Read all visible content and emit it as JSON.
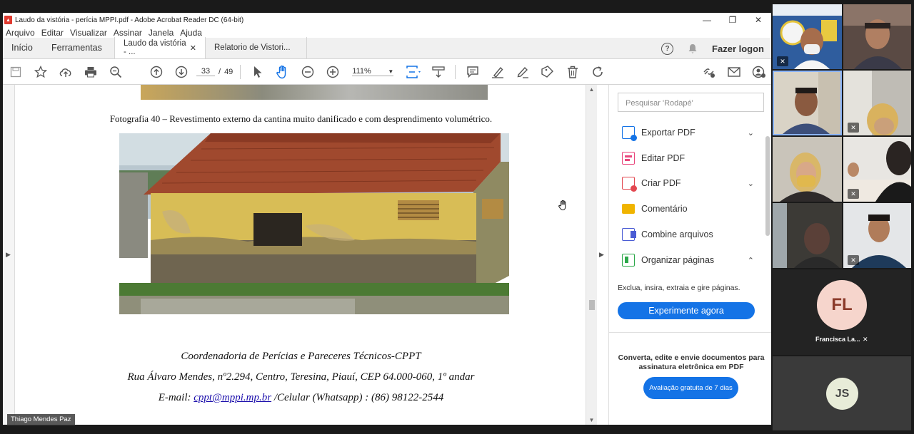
{
  "window": {
    "title": "Laudo da vistória - perícia MPPI.pdf - Adobe Acrobat Reader DC (64-bit)",
    "minimize": "—",
    "maximize": "❐",
    "close": "✕"
  },
  "menu": [
    "Arquivo",
    "Editar",
    "Visualizar",
    "Assinar",
    "Janela",
    "Ajuda"
  ],
  "tabs": {
    "home": "Início",
    "tools": "Ferramentas",
    "doc1": "Laudo da vistória - ...",
    "doc2": "Relatorio de Vistori...",
    "close": "✕",
    "login": "Fazer logon"
  },
  "toolbar": {
    "current_page": "33",
    "page_sep": "/",
    "total_pages": "49",
    "zoom": "111%"
  },
  "document": {
    "caption": "Fotografia 40 – Revestimento externo da cantina muito danificado e com desprendimento volumétrico.",
    "footer_org": "Coordenadoria de Perícias e Pareceres Técnicos-CPPT",
    "footer_address": "Rua Álvaro Mendes, nº2.294, Centro, Teresina, Piauí, CEP 64.000-060, 1º andar",
    "footer_email_label": "E-mail:",
    "footer_email": "cppt@mppi.mp.br",
    "footer_phone": "/Celular (Whatsapp) : (86) 98122-2544"
  },
  "right_panel": {
    "search_placeholder": "Pesquisar 'Rodapé'",
    "tools": [
      {
        "label": "Exportar PDF",
        "color": "#1473e6"
      },
      {
        "label": "Editar PDF",
        "color": "#e9467c"
      },
      {
        "label": "Criar PDF",
        "color": "#e34850"
      },
      {
        "label": "Comentário",
        "color": "#f0b400"
      },
      {
        "label": "Combine arquivos",
        "color": "#4a5cd4"
      },
      {
        "label": "Organizar páginas",
        "color": "#2da84a"
      }
    ],
    "organize_desc": "Exclua, insira, extraia e gire páginas.",
    "try_button": "Experimente agora",
    "promo_text": "Converta, edite e envie documentos para assinatura eletrônica em PDF",
    "trial_button": "Avaliação gratuita de 7 dias"
  },
  "video": {
    "presenter_name": "Thiago Mendes Paz",
    "participant_fl_initials": "FL",
    "participant_fl_name": "Francisca La...",
    "participant_js_initials": "JS"
  },
  "colors": {
    "accent": "#1473e6",
    "fl_avatar": "#f6d5cc",
    "fl_text": "#8b3a2a",
    "js_avatar": "#e8ecd8"
  }
}
